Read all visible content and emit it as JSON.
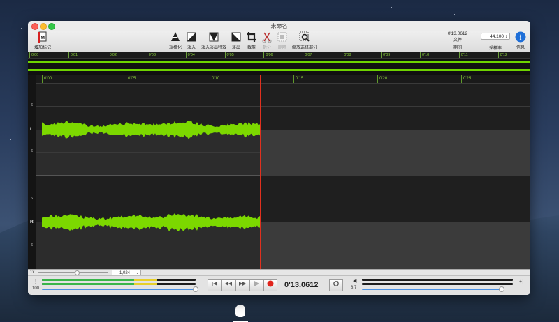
{
  "window": {
    "title": "未命名"
  },
  "toolbar": {
    "add_marker": "增加标记",
    "normalize": "规格化",
    "fade_in": "淡入",
    "fade_in_out": "淡入淡出特效",
    "fade_out": "淡出",
    "crop": "截剪",
    "split": "拆分",
    "delete": "删除",
    "zoom_selection": "缩放选择部分",
    "file_time": "0'13.0612",
    "file_label": "文件",
    "duration_label": "期间",
    "sample_rate": "44,100",
    "sample_rate_label": "采样率",
    "info_label": "信息"
  },
  "overview": {
    "ticks": [
      "0'00",
      "0'01",
      "0'02",
      "0'03",
      "0'04",
      "0'05",
      "0'06",
      "0'07",
      "0'08",
      "0'09",
      "0'10",
      "0'11",
      "0'12"
    ]
  },
  "editor": {
    "ticks": [
      "0'00",
      "0'05",
      "0'10",
      "0'15",
      "0'20",
      "0'25"
    ],
    "left_channel": "L",
    "right_channel": "R",
    "db_marker": "6"
  },
  "zoom": {
    "factor": "1x",
    "value": "1,024"
  },
  "transport": {
    "time": "0'13.0612",
    "input_level": "100",
    "output_level": "8.7"
  },
  "colors": {
    "waveform": "#7cd800",
    "playhead": "#e0301e",
    "record": "#e0241c",
    "accent": "#4a90e2"
  }
}
